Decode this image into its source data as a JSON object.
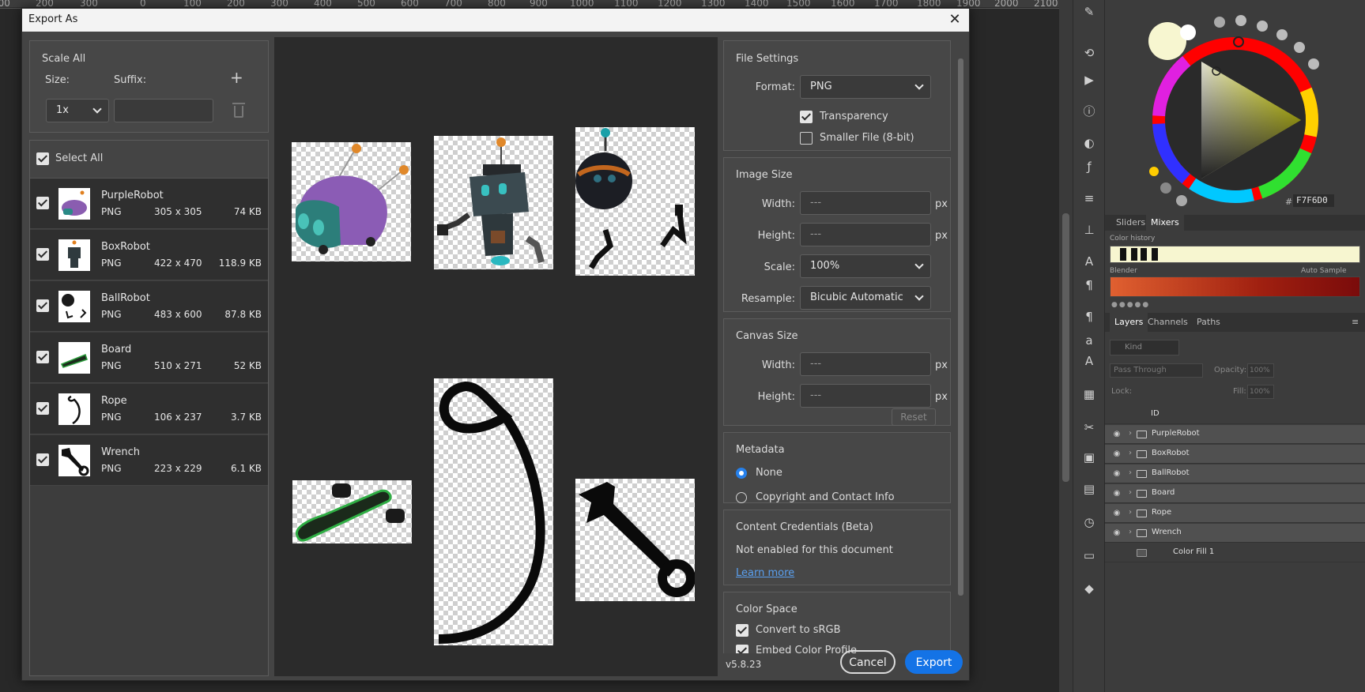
{
  "background_app": {
    "ruler_ticks": [
      "100",
      "200",
      "300",
      "0",
      "100",
      "200",
      "300",
      "400",
      "500",
      "600",
      "700",
      "800",
      "900",
      "1000",
      "1100",
      "1200",
      "1300",
      "1400",
      "1500",
      "1600",
      "1700",
      "1800",
      "1900",
      "2000",
      "2100"
    ],
    "color_panel": {
      "hex_label": "#",
      "hex_value": "F7F6D0",
      "tabs": [
        {
          "label": "Sliders"
        },
        {
          "label": "Mixers"
        }
      ],
      "color_history_label": "Color history",
      "blender_label": "Blender",
      "auto_sample_label": "Auto Sample",
      "foreground_color": "#F7F6D0"
    },
    "layers_panel": {
      "tabs": [
        {
          "label": "Layers"
        },
        {
          "label": "Channels"
        },
        {
          "label": "Paths"
        }
      ],
      "filter_placeholder": "Kind",
      "blend_mode": "Pass Through",
      "opacity_label": "Opacity:",
      "opacity_value": "100%",
      "lock_label": "Lock:",
      "fill_label": "Fill:",
      "fill_value": "100%",
      "id_label": "ID",
      "layers": [
        {
          "name": "PurpleRobot"
        },
        {
          "name": "BoxRobot"
        },
        {
          "name": "BallRobot"
        },
        {
          "name": "Board"
        },
        {
          "name": "Rope"
        },
        {
          "name": "Wrench"
        },
        {
          "name": "Color Fill 1"
        }
      ]
    }
  },
  "dialog": {
    "title": "Export As",
    "scale_all": {
      "title": "Scale All",
      "size_label": "Size:",
      "suffix_label": "Suffix:",
      "size_value": "1x",
      "suffix_value": "",
      "add_icon": "+"
    },
    "select_all_label": "Select All",
    "assets": [
      {
        "name": "PurpleRobot",
        "format": "PNG",
        "dimensions": "305 x 305",
        "size": "74 KB"
      },
      {
        "name": "BoxRobot",
        "format": "PNG",
        "dimensions": "422 x 470",
        "size": "118.9 KB"
      },
      {
        "name": "BallRobot",
        "format": "PNG",
        "dimensions": "483 x 600",
        "size": "87.8 KB"
      },
      {
        "name": "Board",
        "format": "PNG",
        "dimensions": "510 x 271",
        "size": "52 KB"
      },
      {
        "name": "Rope",
        "format": "PNG",
        "dimensions": "106 x 237",
        "size": "3.7 KB"
      },
      {
        "name": "Wrench",
        "format": "PNG",
        "dimensions": "223 x 229",
        "size": "6.1 KB"
      }
    ],
    "file_settings": {
      "title": "File Settings",
      "format_label": "Format:",
      "format_value": "PNG",
      "transparency_label": "Transparency",
      "smaller_file_label": "Smaller File (8-bit)"
    },
    "image_size": {
      "title": "Image Size",
      "width_label": "Width:",
      "width_value": "---",
      "height_label": "Height:",
      "height_value": "---",
      "scale_label": "Scale:",
      "scale_value": "100%",
      "resample_label": "Resample:",
      "resample_value": "Bicubic Automatic",
      "unit": "px"
    },
    "canvas_size": {
      "title": "Canvas Size",
      "width_label": "Width:",
      "width_value": "---",
      "height_label": "Height:",
      "height_value": "---",
      "unit": "px",
      "reset_label": "Reset"
    },
    "metadata": {
      "title": "Metadata",
      "option_none": "None",
      "option_copyright": "Copyright and Contact Info"
    },
    "content_credentials": {
      "title": "Content Credentials (Beta)",
      "status": "Not enabled for this document",
      "learn_more": "Learn more"
    },
    "color_space": {
      "title": "Color Space",
      "convert_label": "Convert to sRGB",
      "embed_label": "Embed Color Profile"
    },
    "version": "v5.8.23",
    "cancel_label": "Cancel",
    "export_label": "Export",
    "accent_color": "#1473E6"
  }
}
